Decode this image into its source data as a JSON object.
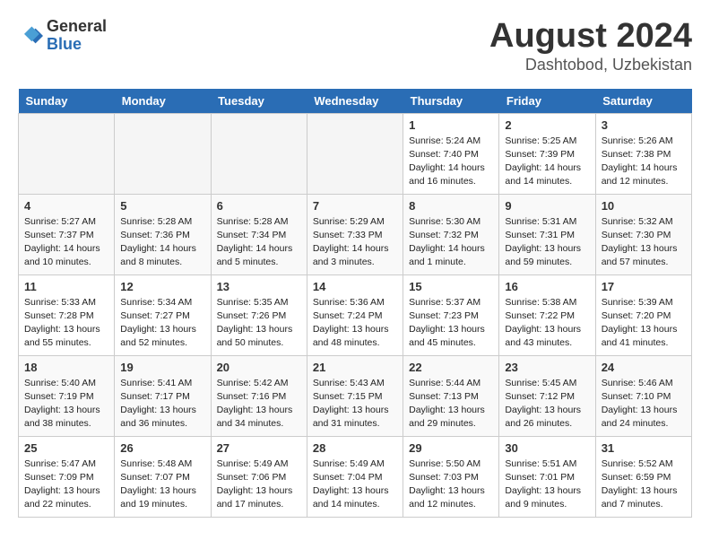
{
  "logo": {
    "general": "General",
    "blue": "Blue"
  },
  "title": {
    "month": "August 2024",
    "location": "Dashtobod, Uzbekistan"
  },
  "weekdays": [
    "Sunday",
    "Monday",
    "Tuesday",
    "Wednesday",
    "Thursday",
    "Friday",
    "Saturday"
  ],
  "weeks": [
    [
      {
        "day": "",
        "info": ""
      },
      {
        "day": "",
        "info": ""
      },
      {
        "day": "",
        "info": ""
      },
      {
        "day": "",
        "info": ""
      },
      {
        "day": "1",
        "info": "Sunrise: 5:24 AM\nSunset: 7:40 PM\nDaylight: 14 hours\nand 16 minutes."
      },
      {
        "day": "2",
        "info": "Sunrise: 5:25 AM\nSunset: 7:39 PM\nDaylight: 14 hours\nand 14 minutes."
      },
      {
        "day": "3",
        "info": "Sunrise: 5:26 AM\nSunset: 7:38 PM\nDaylight: 14 hours\nand 12 minutes."
      }
    ],
    [
      {
        "day": "4",
        "info": "Sunrise: 5:27 AM\nSunset: 7:37 PM\nDaylight: 14 hours\nand 10 minutes."
      },
      {
        "day": "5",
        "info": "Sunrise: 5:28 AM\nSunset: 7:36 PM\nDaylight: 14 hours\nand 8 minutes."
      },
      {
        "day": "6",
        "info": "Sunrise: 5:28 AM\nSunset: 7:34 PM\nDaylight: 14 hours\nand 5 minutes."
      },
      {
        "day": "7",
        "info": "Sunrise: 5:29 AM\nSunset: 7:33 PM\nDaylight: 14 hours\nand 3 minutes."
      },
      {
        "day": "8",
        "info": "Sunrise: 5:30 AM\nSunset: 7:32 PM\nDaylight: 14 hours\nand 1 minute."
      },
      {
        "day": "9",
        "info": "Sunrise: 5:31 AM\nSunset: 7:31 PM\nDaylight: 13 hours\nand 59 minutes."
      },
      {
        "day": "10",
        "info": "Sunrise: 5:32 AM\nSunset: 7:30 PM\nDaylight: 13 hours\nand 57 minutes."
      }
    ],
    [
      {
        "day": "11",
        "info": "Sunrise: 5:33 AM\nSunset: 7:28 PM\nDaylight: 13 hours\nand 55 minutes."
      },
      {
        "day": "12",
        "info": "Sunrise: 5:34 AM\nSunset: 7:27 PM\nDaylight: 13 hours\nand 52 minutes."
      },
      {
        "day": "13",
        "info": "Sunrise: 5:35 AM\nSunset: 7:26 PM\nDaylight: 13 hours\nand 50 minutes."
      },
      {
        "day": "14",
        "info": "Sunrise: 5:36 AM\nSunset: 7:24 PM\nDaylight: 13 hours\nand 48 minutes."
      },
      {
        "day": "15",
        "info": "Sunrise: 5:37 AM\nSunset: 7:23 PM\nDaylight: 13 hours\nand 45 minutes."
      },
      {
        "day": "16",
        "info": "Sunrise: 5:38 AM\nSunset: 7:22 PM\nDaylight: 13 hours\nand 43 minutes."
      },
      {
        "day": "17",
        "info": "Sunrise: 5:39 AM\nSunset: 7:20 PM\nDaylight: 13 hours\nand 41 minutes."
      }
    ],
    [
      {
        "day": "18",
        "info": "Sunrise: 5:40 AM\nSunset: 7:19 PM\nDaylight: 13 hours\nand 38 minutes."
      },
      {
        "day": "19",
        "info": "Sunrise: 5:41 AM\nSunset: 7:17 PM\nDaylight: 13 hours\nand 36 minutes."
      },
      {
        "day": "20",
        "info": "Sunrise: 5:42 AM\nSunset: 7:16 PM\nDaylight: 13 hours\nand 34 minutes."
      },
      {
        "day": "21",
        "info": "Sunrise: 5:43 AM\nSunset: 7:15 PM\nDaylight: 13 hours\nand 31 minutes."
      },
      {
        "day": "22",
        "info": "Sunrise: 5:44 AM\nSunset: 7:13 PM\nDaylight: 13 hours\nand 29 minutes."
      },
      {
        "day": "23",
        "info": "Sunrise: 5:45 AM\nSunset: 7:12 PM\nDaylight: 13 hours\nand 26 minutes."
      },
      {
        "day": "24",
        "info": "Sunrise: 5:46 AM\nSunset: 7:10 PM\nDaylight: 13 hours\nand 24 minutes."
      }
    ],
    [
      {
        "day": "25",
        "info": "Sunrise: 5:47 AM\nSunset: 7:09 PM\nDaylight: 13 hours\nand 22 minutes."
      },
      {
        "day": "26",
        "info": "Sunrise: 5:48 AM\nSunset: 7:07 PM\nDaylight: 13 hours\nand 19 minutes."
      },
      {
        "day": "27",
        "info": "Sunrise: 5:49 AM\nSunset: 7:06 PM\nDaylight: 13 hours\nand 17 minutes."
      },
      {
        "day": "28",
        "info": "Sunrise: 5:49 AM\nSunset: 7:04 PM\nDaylight: 13 hours\nand 14 minutes."
      },
      {
        "day": "29",
        "info": "Sunrise: 5:50 AM\nSunset: 7:03 PM\nDaylight: 13 hours\nand 12 minutes."
      },
      {
        "day": "30",
        "info": "Sunrise: 5:51 AM\nSunset: 7:01 PM\nDaylight: 13 hours\nand 9 minutes."
      },
      {
        "day": "31",
        "info": "Sunrise: 5:52 AM\nSunset: 6:59 PM\nDaylight: 13 hours\nand 7 minutes."
      }
    ]
  ]
}
